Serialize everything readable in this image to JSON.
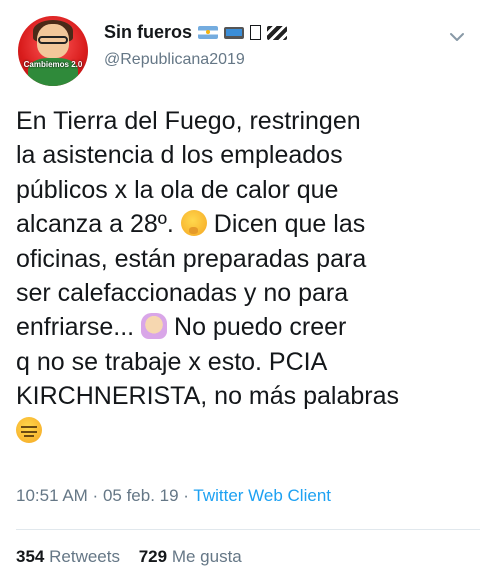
{
  "user": {
    "display_name": "Sin fueros",
    "name_emojis": [
      "flag-argentina-icon",
      "laptop-icon",
      "unknown-glyph-icon",
      "clapper-board-icon"
    ],
    "handle": "@Republicana2019",
    "avatar_text": "Cambiemos 2.0"
  },
  "tweet": {
    "lines": [
      "En Tierra del Fuego, restringen",
      "la asistencia d los empleados",
      "públicos x la ola de calor que",
      "alcanza a 28º.",
      "Dicen que las",
      "oficinas, están preparadas para",
      "ser calefaccionadas y no para",
      "enfriarse...",
      "No puedo creer",
      "q no se trabaje x esto. PCIA",
      "KIRCHNERISTA, no más palabras"
    ],
    "emojis": [
      "thinking-face-icon",
      "facepalm-icon",
      "unamused-face-icon"
    ]
  },
  "meta": {
    "time": "10:51 AM",
    "separator1": " · ",
    "date": "05 feb. 19",
    "separator2": " · ",
    "source": "Twitter Web Client"
  },
  "stats": {
    "retweets_count": "354",
    "retweets_label": "Retweets",
    "likes_count": "729",
    "likes_label": "Me gusta"
  },
  "colors": {
    "text": "#14171a",
    "secondary": "#657786",
    "link": "#1da1f2",
    "divider": "#e1e8ed"
  }
}
